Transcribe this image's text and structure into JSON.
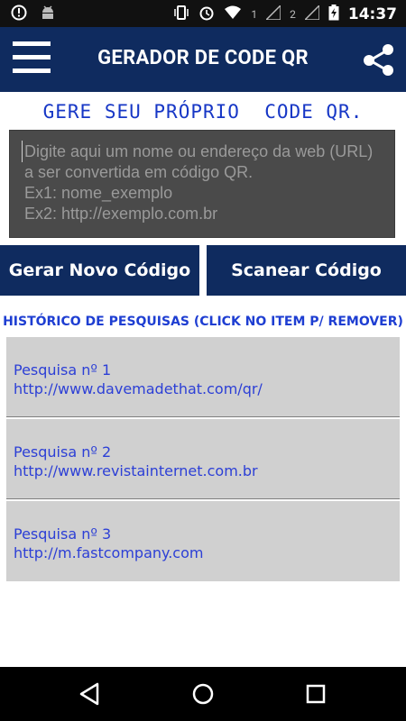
{
  "status_bar": {
    "time": "14:37",
    "sim1": "1",
    "sim2": "2"
  },
  "app_bar": {
    "title": "GERADOR DE CODE QR",
    "background": "#0f2b5f"
  },
  "heading": "GERE SEU PRÓPRIO  CODE QR.",
  "input": {
    "placeholder": "Digite aqui um nome ou endereço da web (URL) a ser convertida em código QR.\nEx1: nome_exemplo\nEx2: http://exemplo.com.br",
    "value": ""
  },
  "buttons": {
    "generate": "Gerar Novo Código",
    "scan": "Scanear Código"
  },
  "history": {
    "title": "HISTÓRICO DE PESQUISAS (CLICK NO ITEM P/ REMOVER)",
    "items": [
      {
        "label": "Pesquisa nº 1",
        "url": "http://www.davemadethat.com/qr/"
      },
      {
        "label": "Pesquisa nº 2",
        "url": "http://www.revistainternet.com.br"
      },
      {
        "label": "Pesquisa nº 3",
        "url": "http://m.fastcompany.com"
      }
    ]
  },
  "icons": {
    "menu": "menu-icon",
    "share": "share-icon",
    "back": "back-icon",
    "home": "home-icon",
    "recents": "recents-icon"
  }
}
